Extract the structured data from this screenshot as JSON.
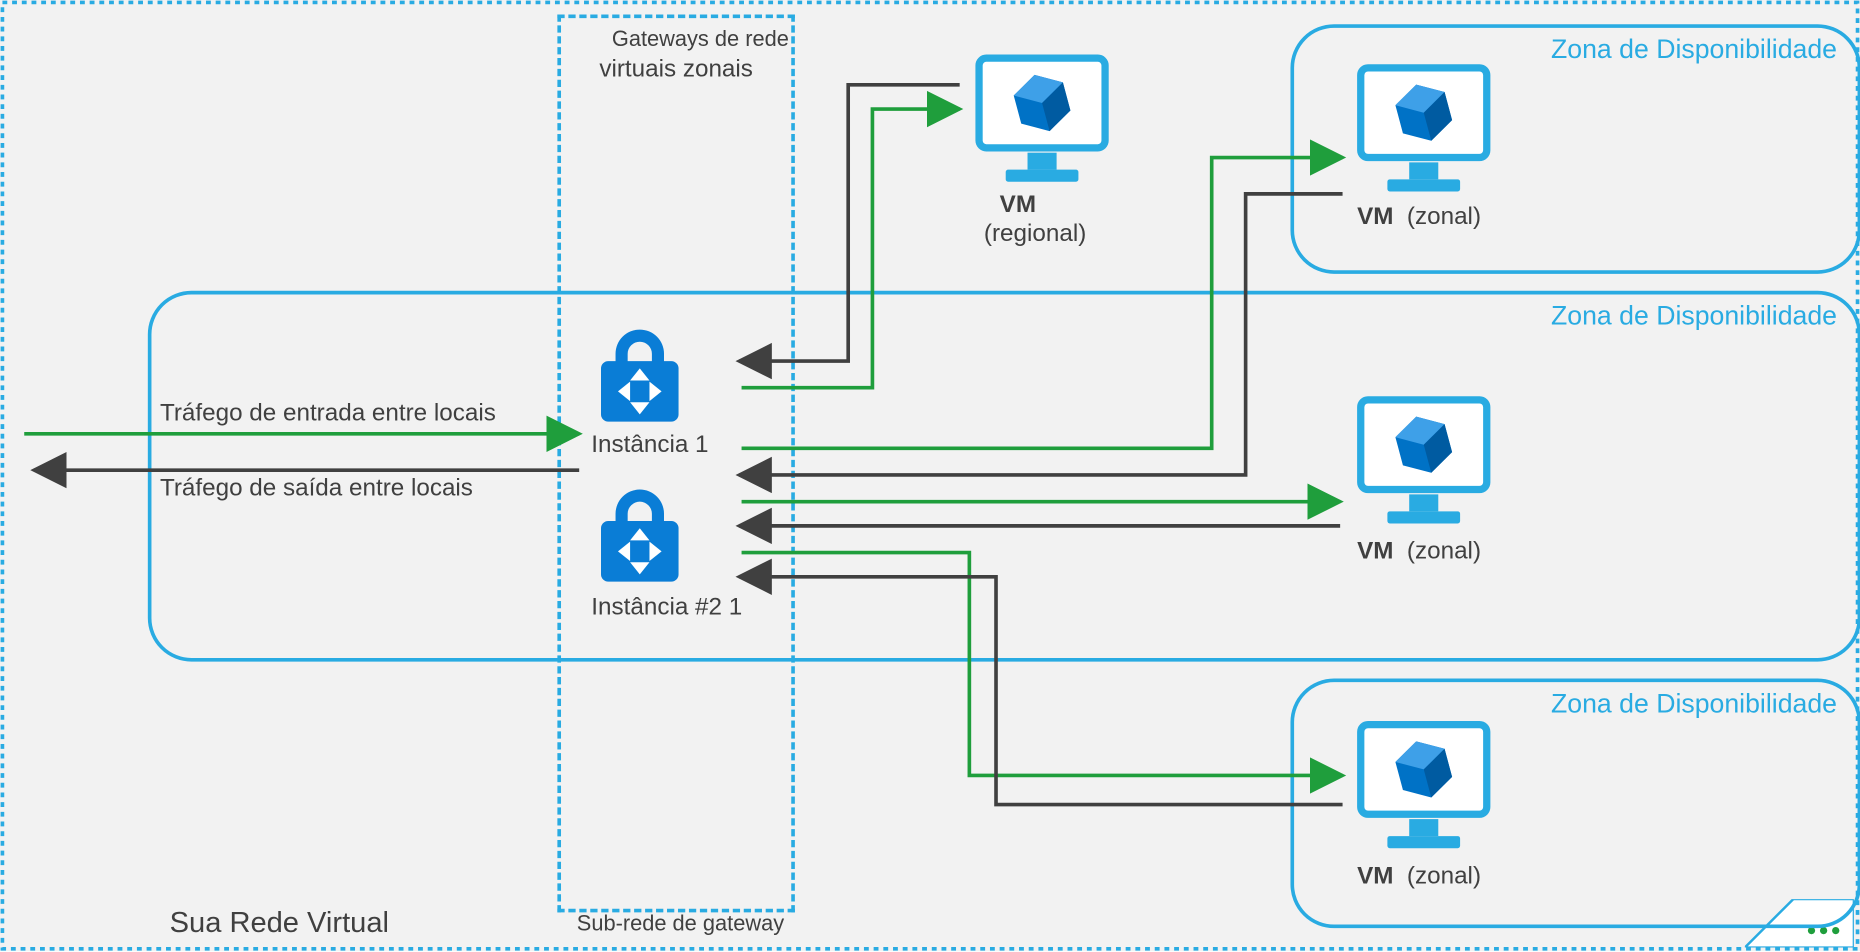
{
  "diagram": {
    "vnet_label": "Sua Rede Virtual",
    "gateway_box_title_line1": "Gateways de rede",
    "gateway_box_title_line2": "virtuais zonais",
    "gateway_subnet_label": "Sub-rede de gateway",
    "instance1_label": "Instância 1",
    "instance2_label": "Instância #2 1",
    "traffic_in_label": "Tráfego de entrada entre locais",
    "traffic_out_label": "Tráfego de saída entre locais",
    "vm_regional_title": "VM",
    "vm_regional_sub": "(regional)",
    "vm_zonal_title": "VM",
    "vm_zonal_sub": "(zonal)",
    "zone_label": "Zona de Disponibilidade"
  },
  "colors": {
    "azure_blue": "#29abe2",
    "dark_blue": "#0072c6",
    "green": "#1f9e3c",
    "black": "#404040",
    "bg": "#f2f2f2"
  }
}
